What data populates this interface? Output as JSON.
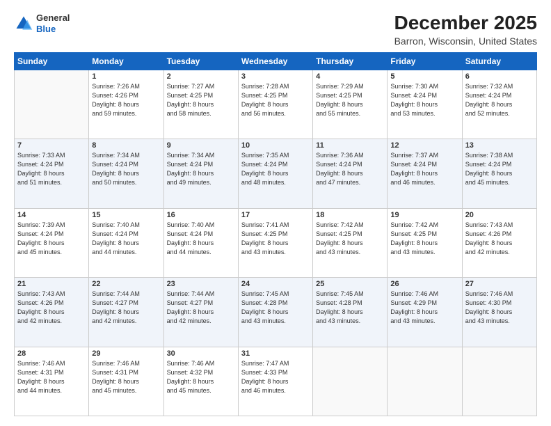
{
  "logo": {
    "line1": "General",
    "line2": "Blue"
  },
  "header": {
    "title": "December 2025",
    "subtitle": "Barron, Wisconsin, United States"
  },
  "days_of_week": [
    "Sunday",
    "Monday",
    "Tuesday",
    "Wednesday",
    "Thursday",
    "Friday",
    "Saturday"
  ],
  "weeks": [
    [
      {
        "day": "",
        "sunrise": "",
        "sunset": "",
        "daylight": ""
      },
      {
        "day": "1",
        "sunrise": "Sunrise: 7:26 AM",
        "sunset": "Sunset: 4:26 PM",
        "daylight": "Daylight: 8 hours and 59 minutes."
      },
      {
        "day": "2",
        "sunrise": "Sunrise: 7:27 AM",
        "sunset": "Sunset: 4:25 PM",
        "daylight": "Daylight: 8 hours and 58 minutes."
      },
      {
        "day": "3",
        "sunrise": "Sunrise: 7:28 AM",
        "sunset": "Sunset: 4:25 PM",
        "daylight": "Daylight: 8 hours and 56 minutes."
      },
      {
        "day": "4",
        "sunrise": "Sunrise: 7:29 AM",
        "sunset": "Sunset: 4:25 PM",
        "daylight": "Daylight: 8 hours and 55 minutes."
      },
      {
        "day": "5",
        "sunrise": "Sunrise: 7:30 AM",
        "sunset": "Sunset: 4:24 PM",
        "daylight": "Daylight: 8 hours and 53 minutes."
      },
      {
        "day": "6",
        "sunrise": "Sunrise: 7:32 AM",
        "sunset": "Sunset: 4:24 PM",
        "daylight": "Daylight: 8 hours and 52 minutes."
      }
    ],
    [
      {
        "day": "7",
        "sunrise": "Sunrise: 7:33 AM",
        "sunset": "Sunset: 4:24 PM",
        "daylight": "Daylight: 8 hours and 51 minutes."
      },
      {
        "day": "8",
        "sunrise": "Sunrise: 7:34 AM",
        "sunset": "Sunset: 4:24 PM",
        "daylight": "Daylight: 8 hours and 50 minutes."
      },
      {
        "day": "9",
        "sunrise": "Sunrise: 7:34 AM",
        "sunset": "Sunset: 4:24 PM",
        "daylight": "Daylight: 8 hours and 49 minutes."
      },
      {
        "day": "10",
        "sunrise": "Sunrise: 7:35 AM",
        "sunset": "Sunset: 4:24 PM",
        "daylight": "Daylight: 8 hours and 48 minutes."
      },
      {
        "day": "11",
        "sunrise": "Sunrise: 7:36 AM",
        "sunset": "Sunset: 4:24 PM",
        "daylight": "Daylight: 8 hours and 47 minutes."
      },
      {
        "day": "12",
        "sunrise": "Sunrise: 7:37 AM",
        "sunset": "Sunset: 4:24 PM",
        "daylight": "Daylight: 8 hours and 46 minutes."
      },
      {
        "day": "13",
        "sunrise": "Sunrise: 7:38 AM",
        "sunset": "Sunset: 4:24 PM",
        "daylight": "Daylight: 8 hours and 45 minutes."
      }
    ],
    [
      {
        "day": "14",
        "sunrise": "Sunrise: 7:39 AM",
        "sunset": "Sunset: 4:24 PM",
        "daylight": "Daylight: 8 hours and 45 minutes."
      },
      {
        "day": "15",
        "sunrise": "Sunrise: 7:40 AM",
        "sunset": "Sunset: 4:24 PM",
        "daylight": "Daylight: 8 hours and 44 minutes."
      },
      {
        "day": "16",
        "sunrise": "Sunrise: 7:40 AM",
        "sunset": "Sunset: 4:24 PM",
        "daylight": "Daylight: 8 hours and 44 minutes."
      },
      {
        "day": "17",
        "sunrise": "Sunrise: 7:41 AM",
        "sunset": "Sunset: 4:25 PM",
        "daylight": "Daylight: 8 hours and 43 minutes."
      },
      {
        "day": "18",
        "sunrise": "Sunrise: 7:42 AM",
        "sunset": "Sunset: 4:25 PM",
        "daylight": "Daylight: 8 hours and 43 minutes."
      },
      {
        "day": "19",
        "sunrise": "Sunrise: 7:42 AM",
        "sunset": "Sunset: 4:25 PM",
        "daylight": "Daylight: 8 hours and 43 minutes."
      },
      {
        "day": "20",
        "sunrise": "Sunrise: 7:43 AM",
        "sunset": "Sunset: 4:26 PM",
        "daylight": "Daylight: 8 hours and 42 minutes."
      }
    ],
    [
      {
        "day": "21",
        "sunrise": "Sunrise: 7:43 AM",
        "sunset": "Sunset: 4:26 PM",
        "daylight": "Daylight: 8 hours and 42 minutes."
      },
      {
        "day": "22",
        "sunrise": "Sunrise: 7:44 AM",
        "sunset": "Sunset: 4:27 PM",
        "daylight": "Daylight: 8 hours and 42 minutes."
      },
      {
        "day": "23",
        "sunrise": "Sunrise: 7:44 AM",
        "sunset": "Sunset: 4:27 PM",
        "daylight": "Daylight: 8 hours and 42 minutes."
      },
      {
        "day": "24",
        "sunrise": "Sunrise: 7:45 AM",
        "sunset": "Sunset: 4:28 PM",
        "daylight": "Daylight: 8 hours and 43 minutes."
      },
      {
        "day": "25",
        "sunrise": "Sunrise: 7:45 AM",
        "sunset": "Sunset: 4:28 PM",
        "daylight": "Daylight: 8 hours and 43 minutes."
      },
      {
        "day": "26",
        "sunrise": "Sunrise: 7:46 AM",
        "sunset": "Sunset: 4:29 PM",
        "daylight": "Daylight: 8 hours and 43 minutes."
      },
      {
        "day": "27",
        "sunrise": "Sunrise: 7:46 AM",
        "sunset": "Sunset: 4:30 PM",
        "daylight": "Daylight: 8 hours and 43 minutes."
      }
    ],
    [
      {
        "day": "28",
        "sunrise": "Sunrise: 7:46 AM",
        "sunset": "Sunset: 4:31 PM",
        "daylight": "Daylight: 8 hours and 44 minutes."
      },
      {
        "day": "29",
        "sunrise": "Sunrise: 7:46 AM",
        "sunset": "Sunset: 4:31 PM",
        "daylight": "Daylight: 8 hours and 45 minutes."
      },
      {
        "day": "30",
        "sunrise": "Sunrise: 7:46 AM",
        "sunset": "Sunset: 4:32 PM",
        "daylight": "Daylight: 8 hours and 45 minutes."
      },
      {
        "day": "31",
        "sunrise": "Sunrise: 7:47 AM",
        "sunset": "Sunset: 4:33 PM",
        "daylight": "Daylight: 8 hours and 46 minutes."
      },
      {
        "day": "",
        "sunrise": "",
        "sunset": "",
        "daylight": ""
      },
      {
        "day": "",
        "sunrise": "",
        "sunset": "",
        "daylight": ""
      },
      {
        "day": "",
        "sunrise": "",
        "sunset": "",
        "daylight": ""
      }
    ]
  ],
  "accent_color": "#1565c0"
}
